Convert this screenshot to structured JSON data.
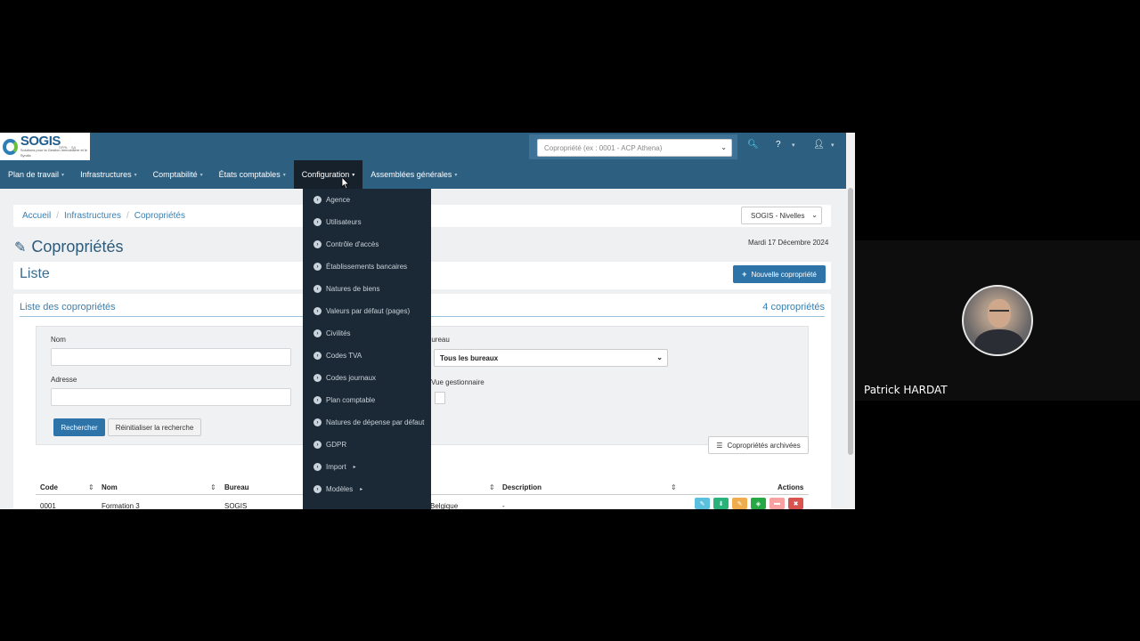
{
  "app": {
    "logo_text": "SOGIS",
    "logo_sub": "Solutions pour la Gestion Immobilière et le Syndic",
    "logo_tag": "SPRL · SA",
    "search_placeholder": "Copropriété (ex : 0001 - ACP Athena)"
  },
  "nav": [
    {
      "label": "Plan de travail"
    },
    {
      "label": "Infrastructures"
    },
    {
      "label": "Comptabilité"
    },
    {
      "label": "États comptables"
    },
    {
      "label": "Configuration"
    },
    {
      "label": "Assemblées générales"
    }
  ],
  "breadcrumb": [
    "Accueil",
    "Infrastructures",
    "Copropriétés"
  ],
  "office_select": "SOGIS - Nivelles",
  "page": {
    "title": "Copropriétés",
    "date": "Mardi 17 Décembre 2024",
    "list_title": "Liste",
    "new_button": "Nouvelle copropriété",
    "list_subtitle": "Liste des copropriétés",
    "count": "4 copropriétés"
  },
  "filters": {
    "nom_label": "Nom",
    "adresse_label": "Adresse",
    "bureau_label": "Bureau",
    "bureau_value": "Tous les bureaux",
    "vue_label": "Vue gestionnaire",
    "search_button": "Rechercher",
    "reset_button": "Réinitialiser la recherche"
  },
  "archived_button": "Copropriétés archivées",
  "table": {
    "headers": {
      "code": "Code",
      "nom": "Nom",
      "bureau": "Bureau",
      "description": "Description",
      "actions": "Actions"
    },
    "row": {
      "code": "0001",
      "nom": "Formation 3",
      "bureau": "SOGIS",
      "pays": "Belgique",
      "description": "-"
    }
  },
  "action_colors": [
    "#5bc0de",
    "#2ab27b",
    "#f0ad4e",
    "#28a745",
    "#f7a1a1",
    "#d9534f"
  ],
  "dropdown": [
    {
      "label": "Agence"
    },
    {
      "label": "Utilisateurs"
    },
    {
      "label": "Contrôle d'accès"
    },
    {
      "label": "Établissements bancaires"
    },
    {
      "label": "Natures de biens"
    },
    {
      "label": "Valeurs par défaut (pages)"
    },
    {
      "label": "Civilités"
    },
    {
      "label": "Codes TVA"
    },
    {
      "label": "Codes journaux"
    },
    {
      "label": "Plan comptable"
    },
    {
      "label": "Natures de dépense par défaut"
    },
    {
      "label": "GDPR"
    },
    {
      "label": "Import"
    },
    {
      "label": "Modèles"
    }
  ],
  "participant": {
    "name": "Patrick HARDAT"
  }
}
